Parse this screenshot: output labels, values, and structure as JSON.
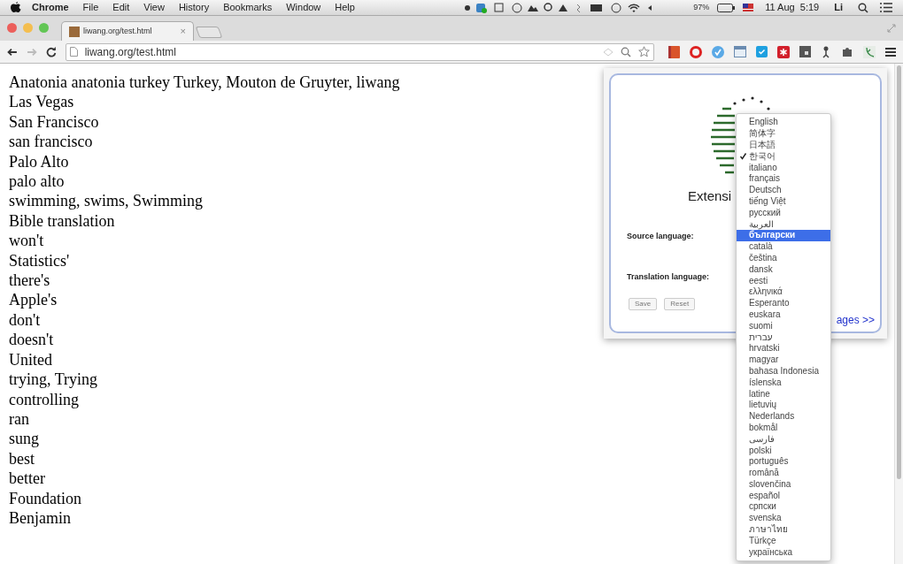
{
  "menu_bar": {
    "app": "Chrome",
    "items": [
      "File",
      "Edit",
      "View",
      "History",
      "Bookmarks",
      "Window",
      "Help"
    ],
    "battery": "97%",
    "clock": "11 Aug  5:19",
    "user": "Li"
  },
  "tab": {
    "title": "liwang.org/test.html",
    "close": "×"
  },
  "address_bar": {
    "url": "liwang.org/test.html"
  },
  "page": {
    "lines": [
      "Anatonia anatonia turkey Turkey, Mouton de Gruyter, liwang",
      "Las Vegas",
      "San Francisco",
      "san francisco",
      "Palo Alto",
      "palo alto",
      "swimming, swims, Swimming",
      "Bible translation",
      "won't",
      "Statistics'",
      "there's",
      "Apple's",
      "don't",
      "doesn't",
      "United",
      "trying, Trying",
      "controlling",
      "ran",
      "sung",
      "best",
      "better",
      "Foundation",
      "Benjamin"
    ]
  },
  "popup": {
    "heading": "Extensi",
    "source_label": "Source language:",
    "translation_label": "Translation language:",
    "buttons": [
      "Save",
      "Reset"
    ],
    "link": "ages >>"
  },
  "language_menu": {
    "items": [
      {
        "label": "English",
        "checked": false,
        "selected": false
      },
      {
        "label": "简体字",
        "checked": false,
        "selected": false
      },
      {
        "label": "日本語",
        "checked": false,
        "selected": false
      },
      {
        "label": "한국어",
        "checked": true,
        "selected": false
      },
      {
        "label": "italiano",
        "checked": false,
        "selected": false
      },
      {
        "label": "français",
        "checked": false,
        "selected": false
      },
      {
        "label": "Deutsch",
        "checked": false,
        "selected": false
      },
      {
        "label": "tiếng Việt",
        "checked": false,
        "selected": false
      },
      {
        "label": "русский",
        "checked": false,
        "selected": false
      },
      {
        "label": "العربية",
        "checked": false,
        "selected": false
      },
      {
        "label": "български",
        "checked": false,
        "selected": true
      },
      {
        "label": "català",
        "checked": false,
        "selected": false
      },
      {
        "label": "čeština",
        "checked": false,
        "selected": false
      },
      {
        "label": "dansk",
        "checked": false,
        "selected": false
      },
      {
        "label": "eesti",
        "checked": false,
        "selected": false
      },
      {
        "label": "ελληνικά",
        "checked": false,
        "selected": false
      },
      {
        "label": "Esperanto",
        "checked": false,
        "selected": false
      },
      {
        "label": "euskara",
        "checked": false,
        "selected": false
      },
      {
        "label": "suomi",
        "checked": false,
        "selected": false
      },
      {
        "label": "עברית",
        "checked": false,
        "selected": false
      },
      {
        "label": "hrvatski",
        "checked": false,
        "selected": false
      },
      {
        "label": "magyar",
        "checked": false,
        "selected": false
      },
      {
        "label": "bahasa Indonesia",
        "checked": false,
        "selected": false
      },
      {
        "label": "íslenska",
        "checked": false,
        "selected": false
      },
      {
        "label": "latine",
        "checked": false,
        "selected": false
      },
      {
        "label": "lietuvių",
        "checked": false,
        "selected": false
      },
      {
        "label": "Nederlands",
        "checked": false,
        "selected": false
      },
      {
        "label": "bokmål",
        "checked": false,
        "selected": false
      },
      {
        "label": "فارسی",
        "checked": false,
        "selected": false
      },
      {
        "label": "polski",
        "checked": false,
        "selected": false
      },
      {
        "label": "português",
        "checked": false,
        "selected": false
      },
      {
        "label": "română",
        "checked": false,
        "selected": false
      },
      {
        "label": "slovenčina",
        "checked": false,
        "selected": false
      },
      {
        "label": "español",
        "checked": false,
        "selected": false
      },
      {
        "label": "српски",
        "checked": false,
        "selected": false
      },
      {
        "label": "svenska",
        "checked": false,
        "selected": false
      },
      {
        "label": "ภาษาไทย",
        "checked": false,
        "selected": false
      },
      {
        "label": "Türkçe",
        "checked": false,
        "selected": false
      },
      {
        "label": "українська",
        "checked": false,
        "selected": false
      }
    ]
  }
}
